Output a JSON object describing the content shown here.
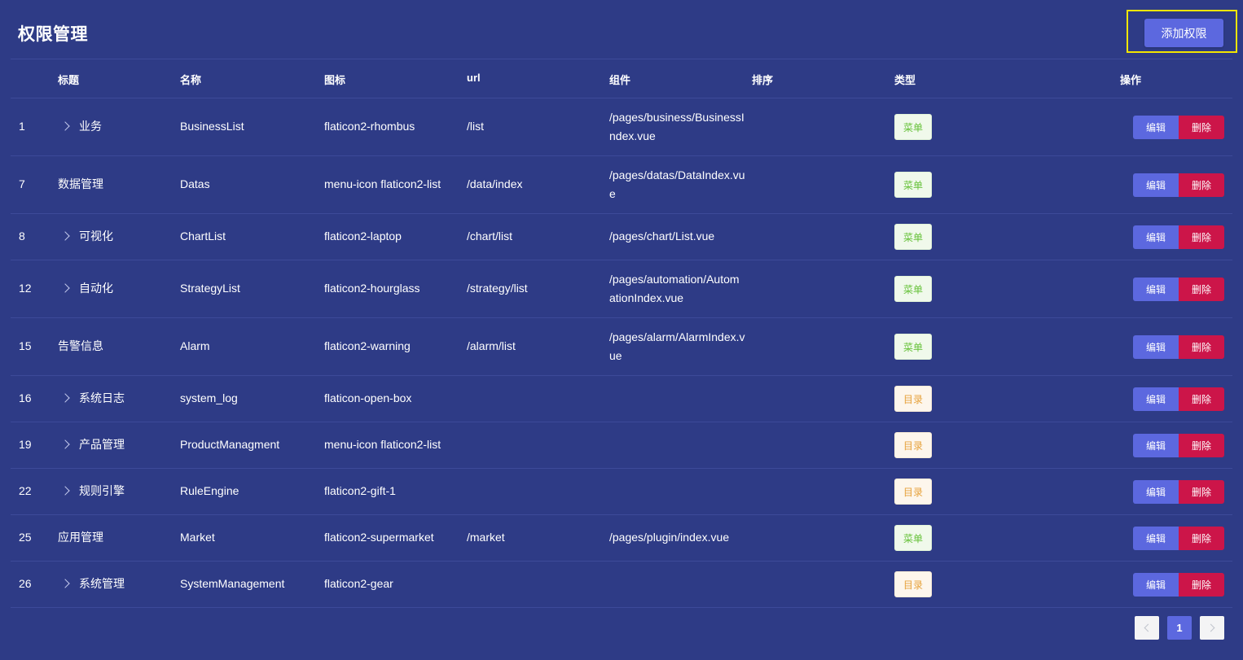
{
  "page": {
    "title": "权限管理",
    "add_button": "添加权限"
  },
  "table": {
    "headers": {
      "title": "标题",
      "name": "名称",
      "icon": "图标",
      "url": "url",
      "component": "组件",
      "sort": "排序",
      "type": "类型",
      "actions": "操作"
    },
    "edit_label": "编辑",
    "delete_label": "删除",
    "rows": [
      {
        "id": "1",
        "title": "业务",
        "expandable": true,
        "name": "BusinessList",
        "icon": "flaticon2-rhombus",
        "url": "/list",
        "component_l1": "/pages/business/BusinessI",
        "component_l2": "ndex.vue",
        "type": "菜单",
        "kind": "menu"
      },
      {
        "id": "7",
        "title": "数据管理",
        "expandable": false,
        "name": "Datas",
        "icon": "menu-icon flaticon2-list",
        "url": "/data/index",
        "component_l1": "/pages/datas/DataIndex.vu",
        "component_l2": "e",
        "type": "菜单",
        "kind": "menu"
      },
      {
        "id": "8",
        "title": "可视化",
        "expandable": true,
        "name": "ChartList",
        "icon": "flaticon2-laptop",
        "url": "/chart/list",
        "component_l1": "/pages/chart/List.vue",
        "component_l2": "",
        "type": "菜单",
        "kind": "menu"
      },
      {
        "id": "12",
        "title": "自动化",
        "expandable": true,
        "name": "StrategyList",
        "icon": "flaticon2-hourglass",
        "url": "/strategy/list",
        "component_l1": "/pages/automation/Autom",
        "component_l2": "ationIndex.vue",
        "type": "菜单",
        "kind": "menu"
      },
      {
        "id": "15",
        "title": "告警信息",
        "expandable": false,
        "name": "Alarm",
        "icon": "flaticon2-warning",
        "url": "/alarm/list",
        "component_l1": "/pages/alarm/AlarmIndex.v",
        "component_l2": "ue",
        "type": "菜单",
        "kind": "menu"
      },
      {
        "id": "16",
        "title": "系统日志",
        "expandable": true,
        "name": "system_log",
        "icon": "flaticon-open-box",
        "url": "",
        "component_l1": "",
        "component_l2": "",
        "type": "目录",
        "kind": "dir"
      },
      {
        "id": "19",
        "title": "产品管理",
        "expandable": true,
        "name": "ProductManagment",
        "icon": "menu-icon flaticon2-list",
        "url": "",
        "component_l1": "",
        "component_l2": "",
        "type": "目录",
        "kind": "dir"
      },
      {
        "id": "22",
        "title": "规则引擎",
        "expandable": true,
        "name": "RuleEngine",
        "icon": "flaticon2-gift-1",
        "url": "",
        "component_l1": "",
        "component_l2": "",
        "type": "目录",
        "kind": "dir"
      },
      {
        "id": "25",
        "title": "应用管理",
        "expandable": false,
        "name": "Market",
        "icon": "flaticon2-supermarket",
        "url": "/market",
        "component_l1": "/pages/plugin/index.vue",
        "component_l2": "",
        "type": "菜单",
        "kind": "menu"
      },
      {
        "id": "26",
        "title": "系统管理",
        "expandable": true,
        "name": "SystemManagement",
        "icon": "flaticon2-gear",
        "url": "",
        "component_l1": "",
        "component_l2": "",
        "type": "目录",
        "kind": "dir"
      }
    ]
  },
  "pagination": {
    "current_page": "1",
    "prev_icon": "chevron-left-icon",
    "next_icon": "chevron-right-icon"
  },
  "colors": {
    "background": "#2e3b86",
    "primary": "#5c68df",
    "danger": "#cc1549",
    "highlight": "#f2e600"
  }
}
